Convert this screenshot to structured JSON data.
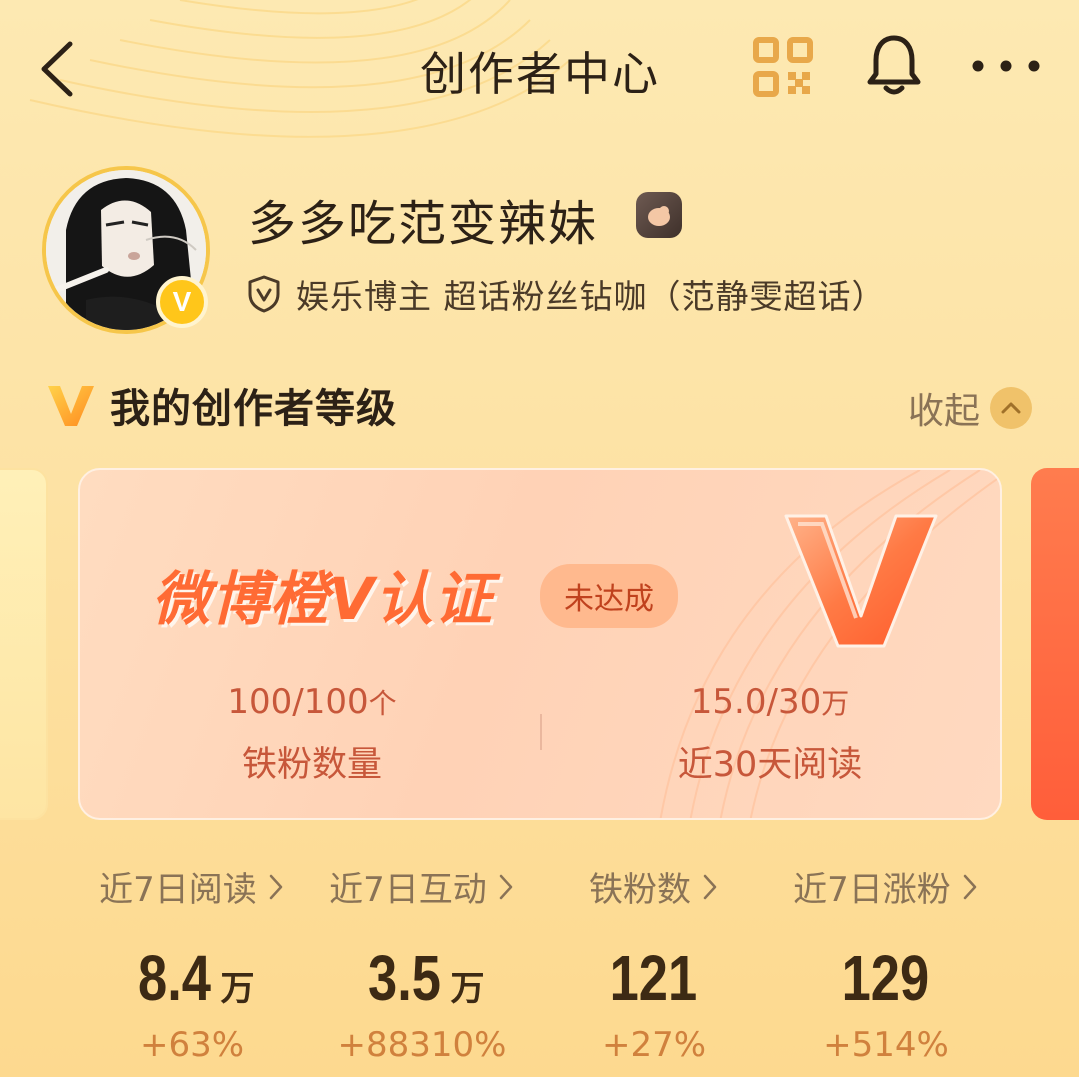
{
  "header": {
    "title": "创作者中心",
    "icons": [
      "back-icon",
      "qr-code-icon",
      "bell-icon",
      "more-icon"
    ]
  },
  "profile": {
    "username": "多多吃范变辣妹",
    "verified_badge": "V",
    "certification": "娱乐博主 超话粉丝钻咖（范静雯超话）"
  },
  "level_section": {
    "title": "我的创作者等级",
    "collapse_label": "收起"
  },
  "card": {
    "title": "微博橙V认证",
    "status": "未达成",
    "stats": [
      {
        "value": "100/100",
        "unit": "个",
        "label": "铁粉数量"
      },
      {
        "value": "15.0/30",
        "unit": "万",
        "label": "近30天阅读"
      }
    ]
  },
  "metrics": [
    {
      "label": "近7日阅读",
      "value": "8.4",
      "unit": "万",
      "change": "+63%"
    },
    {
      "label": "近7日互动",
      "value": "3.5",
      "unit": "万",
      "change": "+88310%"
    },
    {
      "label": "铁粉数",
      "value": "121",
      "unit": "",
      "change": "+27%"
    },
    {
      "label": "近7日涨粉",
      "value": "129",
      "unit": "",
      "change": "+514%"
    }
  ],
  "colors": {
    "accent_orange": "#ff6b34",
    "background": "#fde3a6",
    "verified_yellow": "#ffc61a"
  }
}
